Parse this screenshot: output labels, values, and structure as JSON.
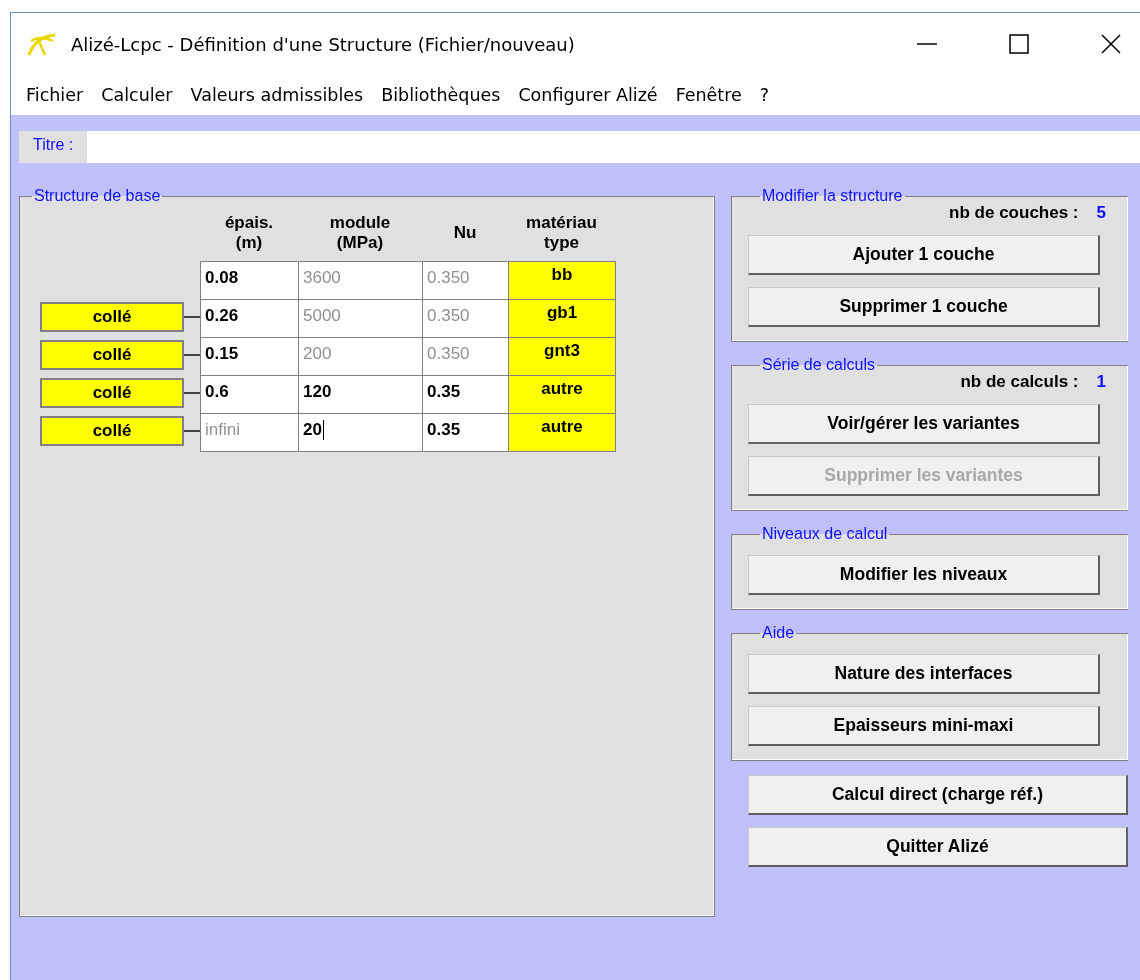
{
  "window": {
    "title": "Alizé-Lcpc - Définition d'une Structure (Fichier/nouveau)"
  },
  "menu": [
    "Fichier",
    "Calculer",
    "Valeurs admissibles",
    "Bibliothèques",
    "Configurer Alizé",
    "Fenêtre",
    "?"
  ],
  "title_field": {
    "label": "Titre :"
  },
  "structure": {
    "legend": "Structure de base",
    "headers": [
      {
        "lines": [
          "épais.",
          "(m)"
        ]
      },
      {
        "lines": [
          "module",
          "(MPa)"
        ]
      },
      {
        "lines": [
          "Nu"
        ]
      },
      {
        "lines": [
          "matériau",
          "type"
        ]
      }
    ],
    "interfaces": [
      "collé",
      "collé",
      "collé",
      "collé"
    ],
    "rows": [
      {
        "cells": [
          {
            "text": "0.08",
            "disabled": false,
            "focused": false
          },
          {
            "text": "3600",
            "disabled": true,
            "focused": false
          },
          {
            "text": "0.350",
            "disabled": true,
            "focused": false
          }
        ],
        "material": "bb"
      },
      {
        "cells": [
          {
            "text": "0.26",
            "disabled": false,
            "focused": false
          },
          {
            "text": "5000",
            "disabled": true,
            "focused": false
          },
          {
            "text": "0.350",
            "disabled": true,
            "focused": false
          }
        ],
        "material": "gb1"
      },
      {
        "cells": [
          {
            "text": "0.15",
            "disabled": false,
            "focused": false
          },
          {
            "text": "200",
            "disabled": true,
            "focused": false
          },
          {
            "text": "0.350",
            "disabled": true,
            "focused": false
          }
        ],
        "material": "gnt3"
      },
      {
        "cells": [
          {
            "text": "0.6",
            "disabled": false,
            "focused": false
          },
          {
            "text": "120",
            "disabled": false,
            "focused": false
          },
          {
            "text": "0.35",
            "disabled": false,
            "focused": false
          }
        ],
        "material": "autre"
      },
      {
        "cells": [
          {
            "text": "infini",
            "disabled": true,
            "focused": false
          },
          {
            "text": "20",
            "disabled": false,
            "focused": true
          },
          {
            "text": "0.35",
            "disabled": false,
            "focused": false
          }
        ],
        "material": "autre"
      }
    ]
  },
  "panels": [
    {
      "legend": "Modifier la structure",
      "count_label": "nb de couches :",
      "count": "5",
      "buttons": [
        {
          "label": "Ajouter 1 couche",
          "disabled": false
        },
        {
          "label": "Supprimer 1 couche",
          "disabled": false
        }
      ]
    },
    {
      "legend": "Série de calculs",
      "count_label": "nb de calculs :",
      "count": "1",
      "buttons": [
        {
          "label": "Voir/gérer les variantes",
          "disabled": false
        },
        {
          "label": "Supprimer les variantes",
          "disabled": true
        }
      ]
    },
    {
      "legend": "Niveaux de calcul",
      "buttons": [
        {
          "label": "Modifier les niveaux",
          "disabled": false
        }
      ]
    },
    {
      "legend": "Aide",
      "buttons": [
        {
          "label": "Nature des interfaces",
          "disabled": false
        },
        {
          "label": "Epaisseurs mini-maxi",
          "disabled": false
        }
      ]
    }
  ],
  "actions": [
    {
      "label": "Calcul direct (charge réf.)",
      "disabled": false
    },
    {
      "label": "Quitter Alizé",
      "disabled": false
    }
  ]
}
